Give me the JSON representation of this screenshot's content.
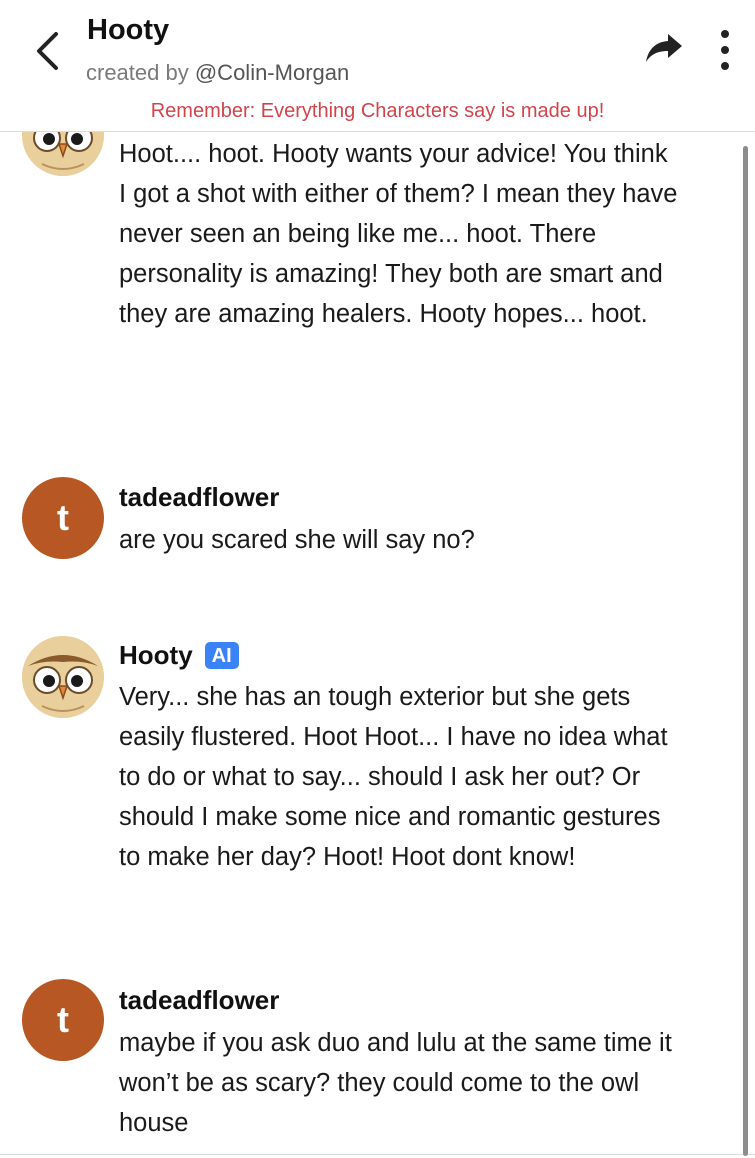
{
  "header": {
    "title": "Hooty",
    "created_by_prefix": "created by ",
    "creator_handle": "@Colin-Morgan",
    "disclaimer": "Remember: Everything Characters say is made up!"
  },
  "icons": {
    "back": "chevron-left-icon",
    "share": "share-arrow-icon",
    "more": "more-vertical-icon"
  },
  "messages": [
    {
      "sender": "",
      "avatar": "owl",
      "text": "Hoot.... hoot. Hooty wants your advice! You think I got a shot with either of them? I mean they have never seen an being like me... hoot. There personality is amazing! They both are smart and they are amazing healers. Hooty hopes... hoot."
    },
    {
      "sender": "tadeadflower",
      "avatar_letter": "t",
      "text": "are you scared she will say no?"
    },
    {
      "sender": "Hooty",
      "badge": "AI",
      "avatar": "owl",
      "text": "Very... she has an tough exterior but she gets easily flustered. Hoot Hoot... I have no idea what to do or what to say... should I ask her out? Or should I make some nice and romantic gestures to make her day? Hoot! Hoot dont know!"
    },
    {
      "sender": "tadeadflower",
      "avatar_letter": "t",
      "text": "maybe if you ask duo and lulu at the same time it won’t be as scary? they could come to the owl house"
    }
  ],
  "colors": {
    "disclaimer": "#d0454c",
    "user_avatar": "#b75723",
    "ai_badge": "#3b82f6"
  }
}
